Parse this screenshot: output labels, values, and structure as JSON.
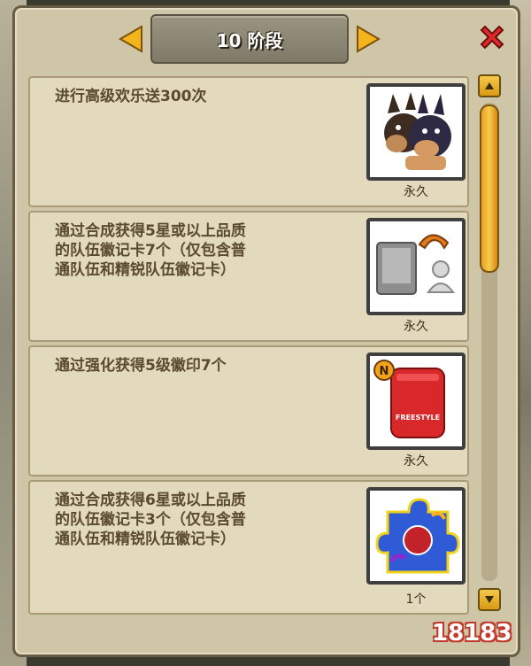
{
  "header": {
    "stage_title": "10 阶段"
  },
  "tasks": [
    {
      "description": "进行高级欢乐送300次",
      "reward_icon": "twin-dog-head-icon",
      "reward_label": "永久"
    },
    {
      "description": "通过合成获得5星或以上品质\n的队伍徽记卡7个（仅包含普\n通队伍和精锐队伍徽记卡）",
      "reward_icon": "card-to-avatar-icon",
      "reward_label": "永久"
    },
    {
      "description": "通过强化获得5级徽印7个",
      "reward_icon": "red-backpack-icon",
      "reward_label": "永久",
      "reward_badge": "N",
      "reward_text": "FREESTYLE"
    },
    {
      "description": "通过合成获得6星或以上品质\n的队伍徽记卡3个（仅包含普\n通队伍和精锐队伍徽记卡）",
      "reward_icon": "puzzle-piece-icon",
      "reward_label": "1个"
    }
  ],
  "watermark": "18183"
}
